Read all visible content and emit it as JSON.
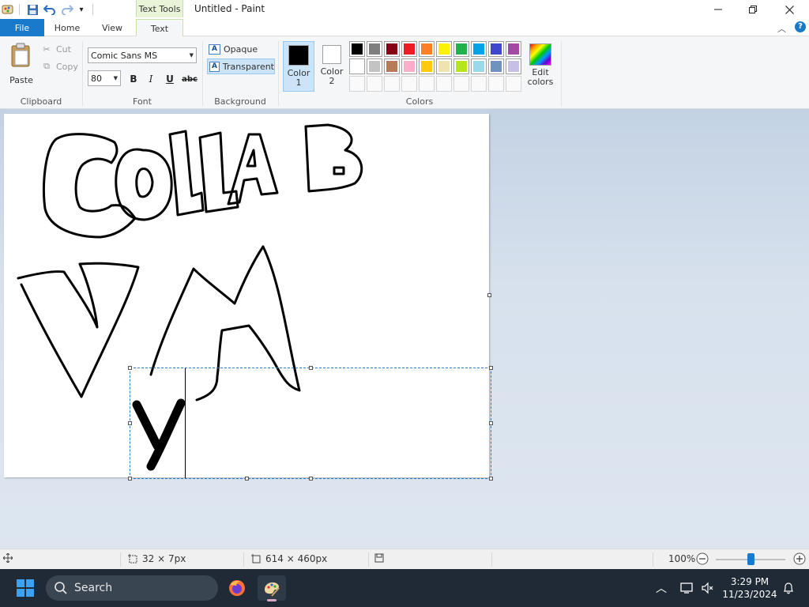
{
  "window": {
    "title": "Untitled - Paint",
    "context_tab": "Text Tools"
  },
  "tabs": {
    "file": "File",
    "home": "Home",
    "view": "View",
    "text": "Text"
  },
  "clipboard": {
    "paste": "Paste",
    "cut": "Cut",
    "copy": "Copy",
    "label": "Clipboard"
  },
  "font": {
    "family": "Comic Sans MS",
    "size": "80",
    "bold": "B",
    "italic": "I",
    "underline": "U",
    "strikethrough": "abc",
    "label": "Font"
  },
  "background": {
    "opaque": "Opaque",
    "transparent": "Transparent",
    "label": "Background"
  },
  "colors": {
    "color1_label_a": "Color",
    "color1_label_b": "1",
    "color2_label_a": "Color",
    "color2_label_b": "2",
    "color1": "#000000",
    "color2": "#ffffff",
    "label": "Colors",
    "edit_a": "Edit",
    "edit_b": "colors",
    "palette_row1": [
      "#000000",
      "#7f7f7f",
      "#880015",
      "#ed1c24",
      "#ff7f27",
      "#fff200",
      "#22b14c",
      "#00a2e8",
      "#3f48cc",
      "#a349a4"
    ],
    "palette_row2": [
      "#ffffff",
      "#c3c3c3",
      "#b97a57",
      "#ffaec9",
      "#ffc90e",
      "#efe4b0",
      "#b5e61d",
      "#99d9ea",
      "#7092be",
      "#c8bfe7"
    ]
  },
  "canvas": {
    "text_content": "y"
  },
  "status": {
    "selection_size": "32 × 7px",
    "canvas_size": "614 × 460px",
    "zoom": "100%",
    "zoom_level": 0.5
  },
  "taskbar": {
    "search": "Search",
    "time": "3:29 PM",
    "date": "11/23/2024"
  }
}
